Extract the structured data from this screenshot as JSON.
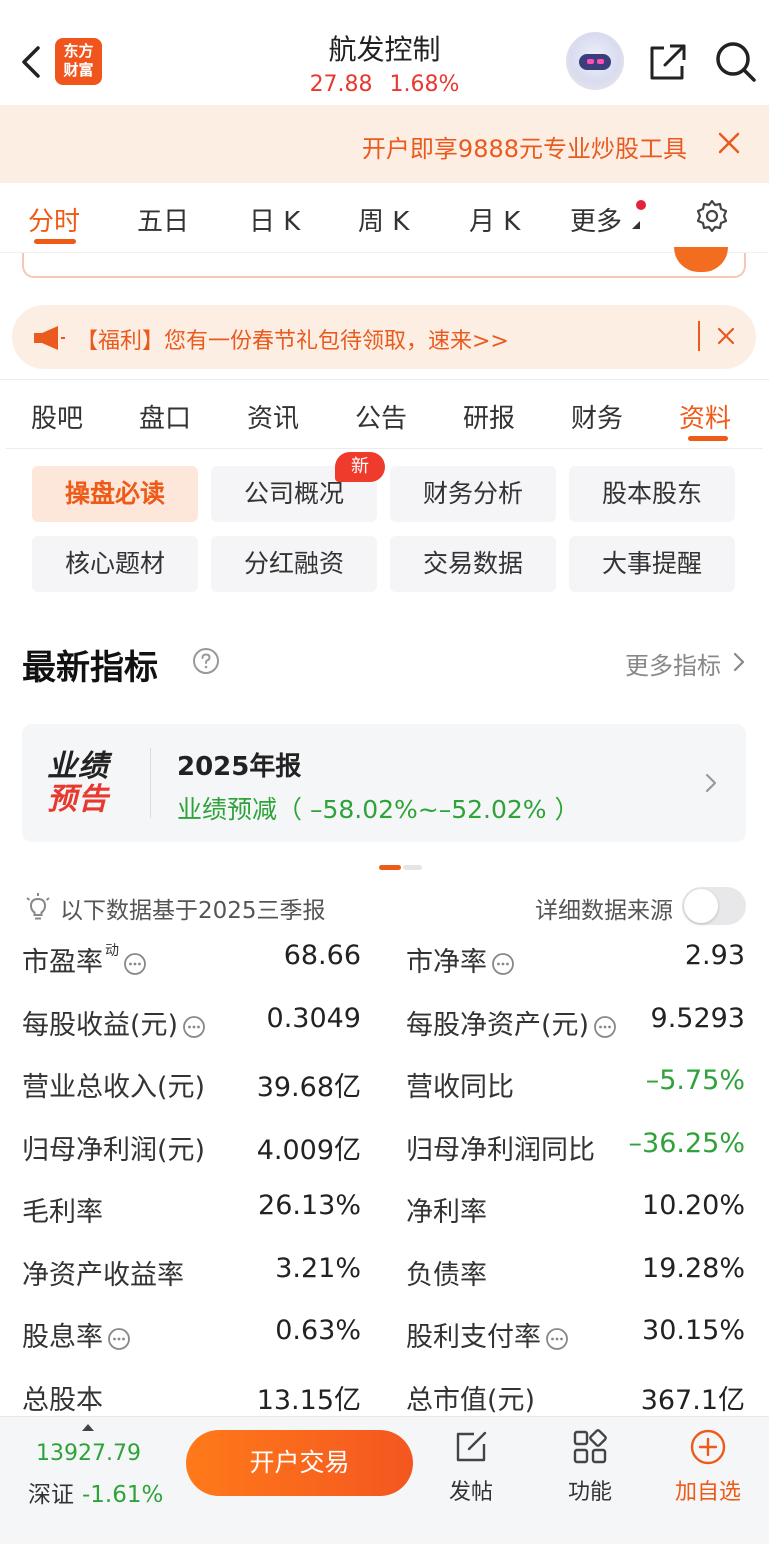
{
  "header": {
    "title": "航发控制",
    "price": "27.88",
    "change_pct": "1.68%",
    "logo_text_line1": "东方",
    "logo_text_line2": "财富"
  },
  "promo": {
    "text": "开户即享9888元专业炒股工具"
  },
  "chart_tabs": [
    "分时",
    "五日",
    "日 K",
    "周 K",
    "月 K",
    "更多"
  ],
  "notice": {
    "text": "【福利】您有一份春节礼包待领取，速来>>"
  },
  "section_tabs": [
    "股吧",
    "盘口",
    "资讯",
    "公告",
    "研报",
    "财务",
    "资料"
  ],
  "sub_tabs": [
    "操盘必读",
    "公司概况",
    "财务分析",
    "股本股东",
    "核心题材",
    "分红融资",
    "交易数据",
    "大事提醒"
  ],
  "new_badge": "新",
  "indicators": {
    "title": "最新指标",
    "more_link": "更多指标"
  },
  "report_card": {
    "logo_line1": "业绩",
    "logo_line2": "预告",
    "title": "2025年报",
    "subtitle": "业绩预减（ –58.02%~–52.02% ）"
  },
  "data_basis": "以下数据基于2025三季报",
  "source_label": "详细数据来源",
  "source_toggle_on": false,
  "metrics": [
    {
      "label": "市盈率",
      "sup": "动",
      "info": true,
      "value": "68.66",
      "label2": "市净率",
      "info2": true,
      "value2": "2.93"
    },
    {
      "label": "每股收益(元)",
      "info": true,
      "value": "0.3049",
      "label2": "每股净资产(元)",
      "info2": true,
      "value2": "9.5293"
    },
    {
      "label": "营业总收入(元)",
      "value": "39.68亿",
      "label2": "营收同比",
      "value2": "–5.75%"
    },
    {
      "label": "归母净利润(元)",
      "value": "4.009亿",
      "label2": "归母净利润同比",
      "value2": "–36.25%"
    },
    {
      "label": "毛利率",
      "value": "26.13%",
      "label2": "净利率",
      "value2": "10.20%"
    },
    {
      "label": "净资产收益率",
      "value": "3.21%",
      "label2": "负债率",
      "value2": "19.28%"
    },
    {
      "label": "股息率",
      "info": true,
      "value": "0.63%",
      "label2": "股利支付率",
      "info2": true,
      "value2": "30.15%"
    },
    {
      "label": "总股本",
      "value": "13.15亿",
      "label2": "总市值(元)",
      "value2": "367.1亿"
    }
  ],
  "bottom_bar": {
    "index_value": "13927.79",
    "index_name": "深证",
    "index_change": "-1.61%",
    "trade_button": "开户交易",
    "post_label": "发帖",
    "function_label": "功能",
    "watchlist_label": "加自选"
  },
  "colors": {
    "accent": "#ee5a17",
    "up": "#e8392f",
    "down": "#2fa33a"
  }
}
